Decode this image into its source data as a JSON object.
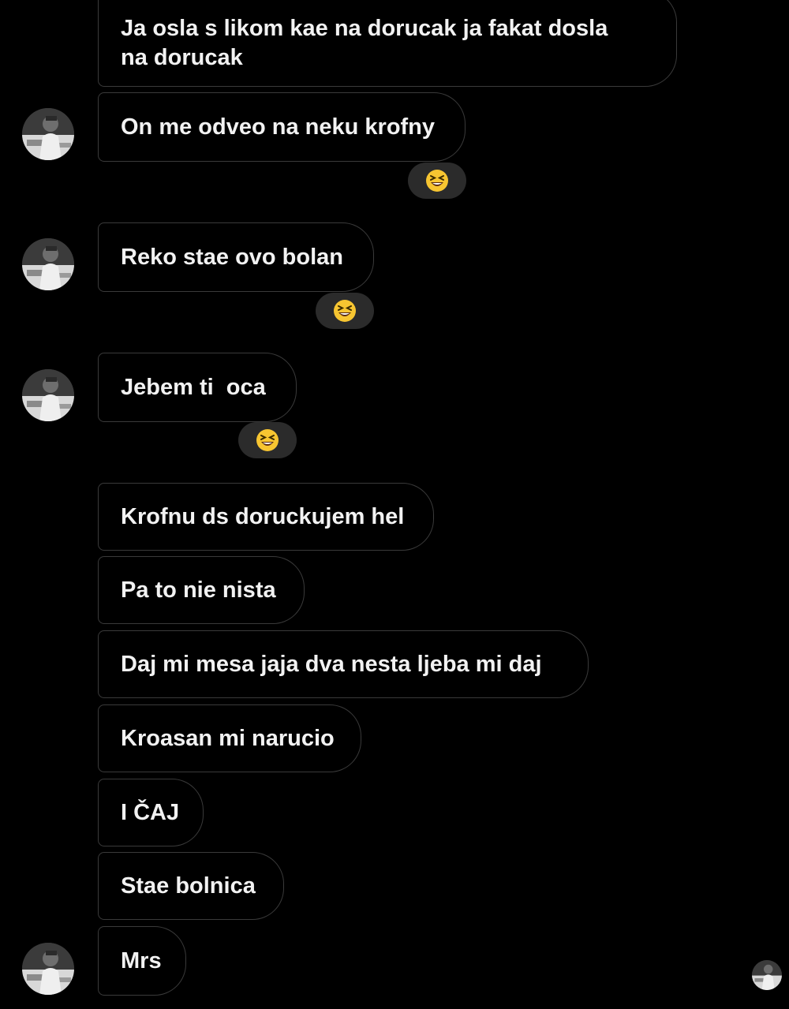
{
  "messages": [
    {
      "text": "Ja osla s likom kae na dorucak ja fakat dosla\nna dorucak"
    },
    {
      "text": "On me odveo na neku krofny",
      "reaction": "laughing-emoji"
    },
    {
      "text": "Reko stae ovo bolan",
      "reaction": "laughing-emoji"
    },
    {
      "text": "Jebem ti  oca",
      "reaction": "laughing-emoji"
    },
    {
      "text": "Krofnu ds doruckujem hel"
    },
    {
      "text": "Pa to nie nista"
    },
    {
      "text": "Daj mi mesa jaja dva nesta ljeba mi daj"
    },
    {
      "text": "Kroasan mi narucio"
    },
    {
      "text": "I ČAJ"
    },
    {
      "text": "Stae bolnica"
    },
    {
      "text": "Mrs"
    }
  ],
  "colors": {
    "background": "#000000",
    "bubble_border": "#3a3a3a",
    "text": "#f2f2f2",
    "reaction_pill": "#2b2b2b",
    "emoji_face": "#f7c531"
  },
  "icons": {
    "avatar": "profile-photo-avatar",
    "reaction": "grinning-squinting-face-emoji",
    "seen": "seen-avatar-icon"
  }
}
